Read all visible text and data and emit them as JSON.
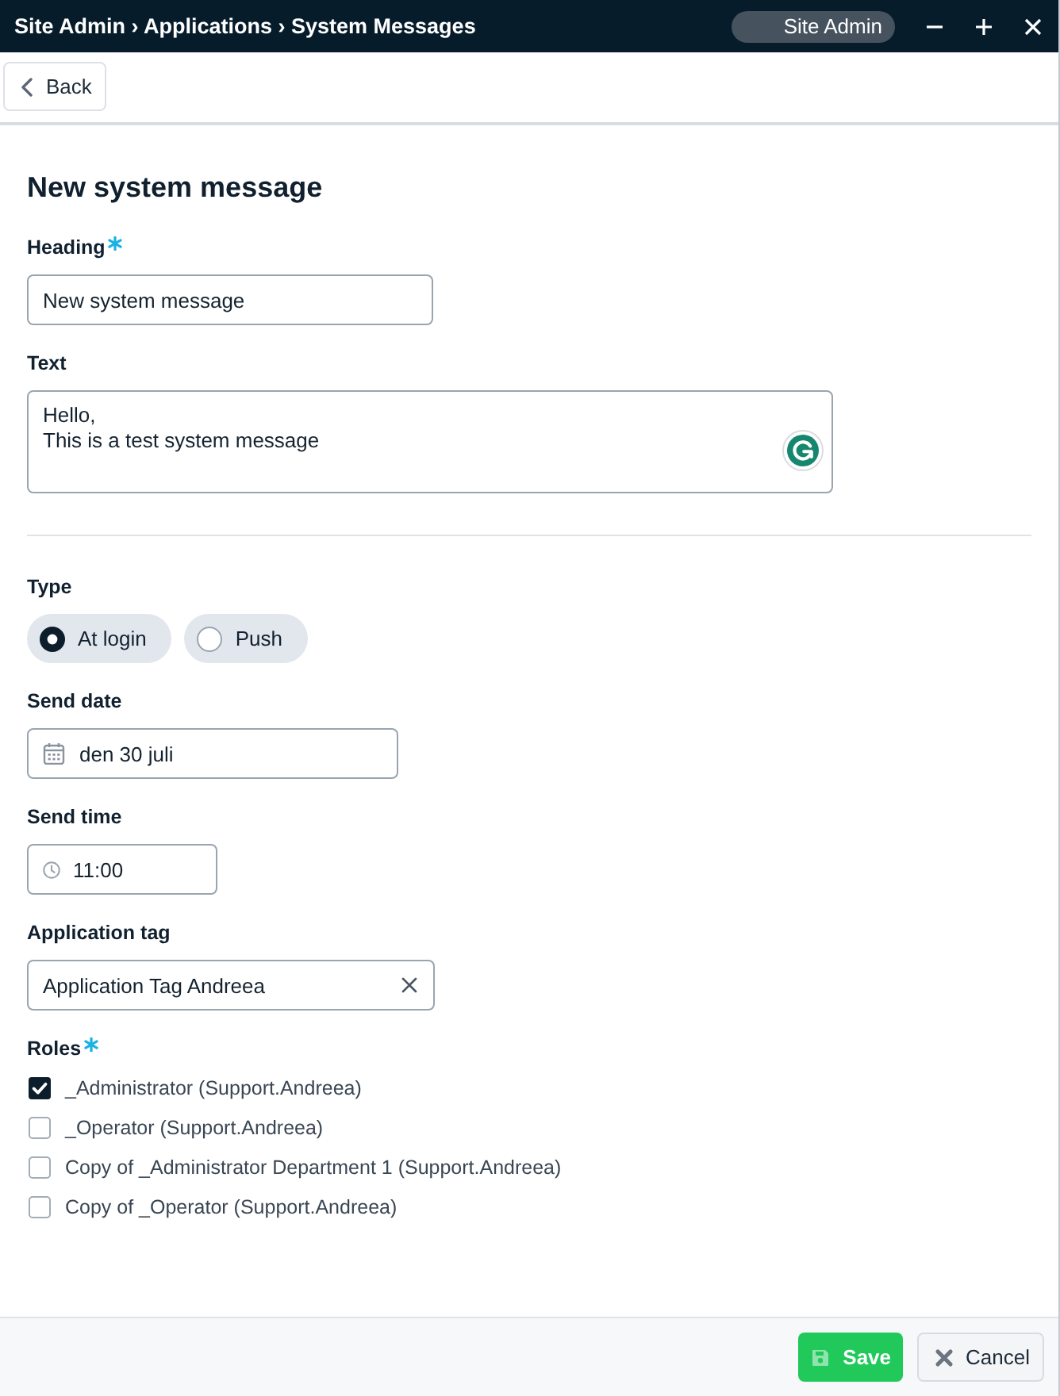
{
  "window": {
    "title": "Site Admin › Applications › System Messages",
    "user_badge": "Site Admin"
  },
  "toolbar": {
    "back_button": "Back"
  },
  "form": {
    "title": "New system message",
    "heading": {
      "label": "Heading",
      "required": true,
      "value": "New system message"
    },
    "text": {
      "label": "Text",
      "required": false,
      "value": "Hello,\nThis is a test system message"
    },
    "type": {
      "label": "Type",
      "required": false,
      "options": [
        {
          "label": "At login",
          "selected": true
        },
        {
          "label": "Push",
          "selected": false
        }
      ]
    },
    "send_date": {
      "label": "Send date",
      "required": false,
      "value": "den 30 juli"
    },
    "send_time": {
      "label": "Send time",
      "required": false,
      "value": "11:00"
    },
    "application_tag": {
      "label": "Application tag",
      "required": false,
      "value": "Application Tag Andreea"
    },
    "roles": {
      "label": "Roles",
      "required": true,
      "items": [
        {
          "label": "_Administrator (Support.Andreea)",
          "checked": true
        },
        {
          "label": "_Operator (Support.Andreea)",
          "checked": false
        },
        {
          "label": "Copy of _Administrator Department 1 (Support.Andreea)",
          "checked": false
        },
        {
          "label": "Copy of _Operator (Support.Andreea)",
          "checked": false
        }
      ]
    }
  },
  "footer": {
    "buttons": [
      {
        "kind": "save",
        "label": "Save"
      },
      {
        "kind": "cancel",
        "label": "Cancel"
      }
    ]
  }
}
